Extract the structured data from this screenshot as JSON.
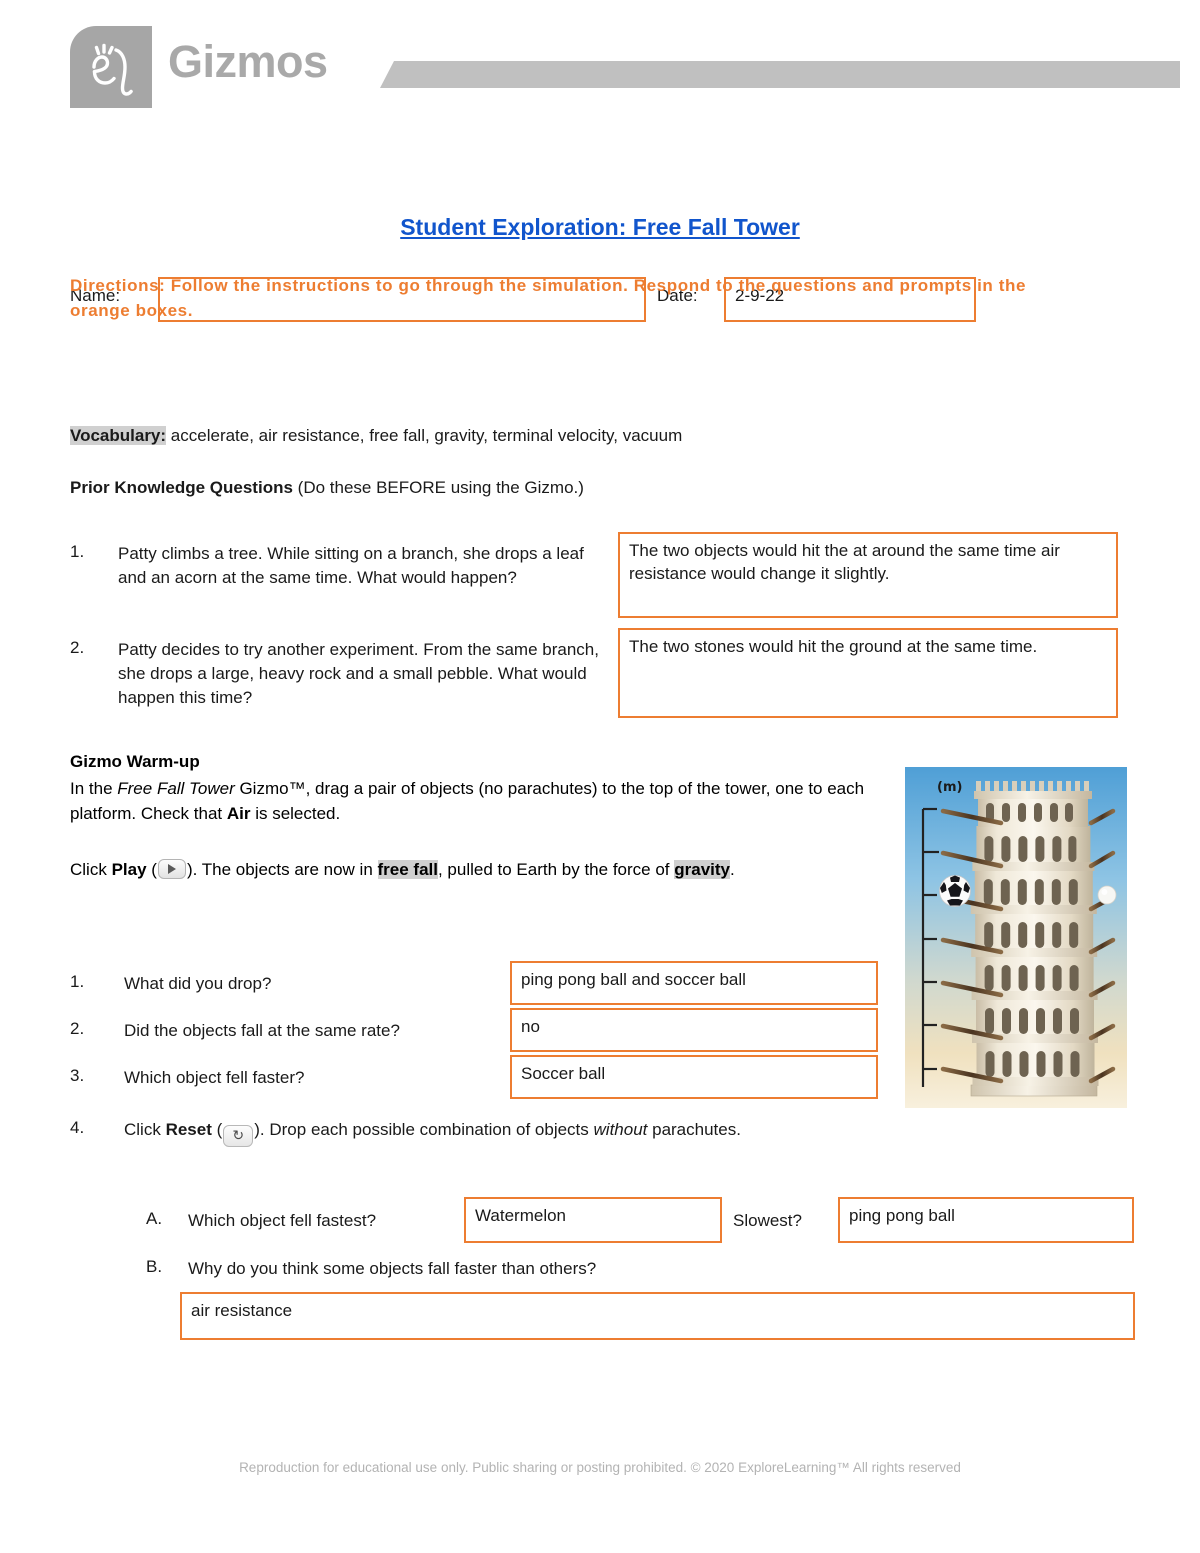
{
  "brand": {
    "logo_icon": "el-script-logo-icon",
    "wordmark": "Gizmos"
  },
  "identity": {
    "name_label": "Name:",
    "name_value": "",
    "name_placeholder": "",
    "date_label": "Date:",
    "date_value": "2-9-22"
  },
  "title": "Student Exploration: Free Fall Tower",
  "directions": "Directions: Follow the instructions to go through the simulation. Respond to the questions and prompts in the orange boxes.",
  "vocabulary": {
    "label": "Vocabulary:",
    "terms": "accelerate, air resistance, free fall, gravity, terminal velocity, vacuum"
  },
  "prior_knowledge": {
    "heading_bold": "Prior Knowledge Questions",
    "heading_rest": "(Do these BEFORE using the Gizmo.)",
    "questions": [
      {
        "number": "1.",
        "prompt": "Patty climbs a tree. While sitting on a branch, she drops a leaf and an acorn at the same time. What would happen?",
        "answer": "The two objects would hit the at around the same time air resistance would change it slightly."
      },
      {
        "number": "2.",
        "prompt": "Patty decides to try another experiment. From the same branch, she drops a large, heavy rock and a small pebble. What would happen this time?",
        "answer": "The two stones would hit the ground at the same time."
      }
    ]
  },
  "warmup": {
    "heading": "Gizmo Warm-up",
    "para1_a": "In the ",
    "para1_italic": "Free Fall Tower",
    "para1_b": " Gizmo™, drag a pair of objects (no parachutes) to the top of the tower, one to each platform. Check that ",
    "para1_bold": "Air",
    "para1_c": " is selected.",
    "para2_a": "Click ",
    "para2_bold_play": "Play",
    "para2_b": " (",
    "para2_c": "). The objects are now in ",
    "para2_hl_freefall": "free fall",
    "para2_d": ", pulled to Earth by the force of ",
    "para2_hl_gravity": "gravity",
    "para2_e": ".",
    "play_icon": "play-icon",
    "reset_icon": "reset-icon",
    "questions": [
      {
        "number": "1.",
        "prompt": "What did you drop?",
        "answer": "ping pong ball and soccer ball"
      },
      {
        "number": "2.",
        "prompt": "Did the objects fall at the same rate?",
        "answer": "no"
      },
      {
        "number": "3.",
        "prompt": "Which object fell faster?",
        "answer": "Soccer ball"
      }
    ],
    "q4": {
      "number": "4.",
      "text_a": "Click ",
      "text_bold": "Reset",
      "text_b": " (",
      "text_c": "). Drop each possible combination of objects ",
      "text_italic": "without",
      "text_d": " parachutes."
    },
    "sub_a": {
      "letter": "A.",
      "prompt": "Which object fell fastest?",
      "answer_fastest": "Watermelon",
      "middle_label": "Slowest?",
      "answer_slowest": "ping pong ball"
    },
    "sub_b": {
      "letter": "B.",
      "prompt": "Why do you think some objects fall faster than others?",
      "answer": "air resistance"
    }
  },
  "figure": {
    "name": "free-fall-tower-illustration",
    "axis_unit_label": "(m)",
    "objects": [
      "soccer-ball",
      "ping-pong-ball"
    ]
  },
  "footer": "Reproduction for educational use only. Public sharing or posting prohibited. © 2020 ExploreLearning™ All rights reserved",
  "colors": {
    "accent_orange": "#ED7D31",
    "title_blue": "#1155cc",
    "brand_grey": "#a6a6a6",
    "highlight_grey": "#d0d0d0"
  }
}
